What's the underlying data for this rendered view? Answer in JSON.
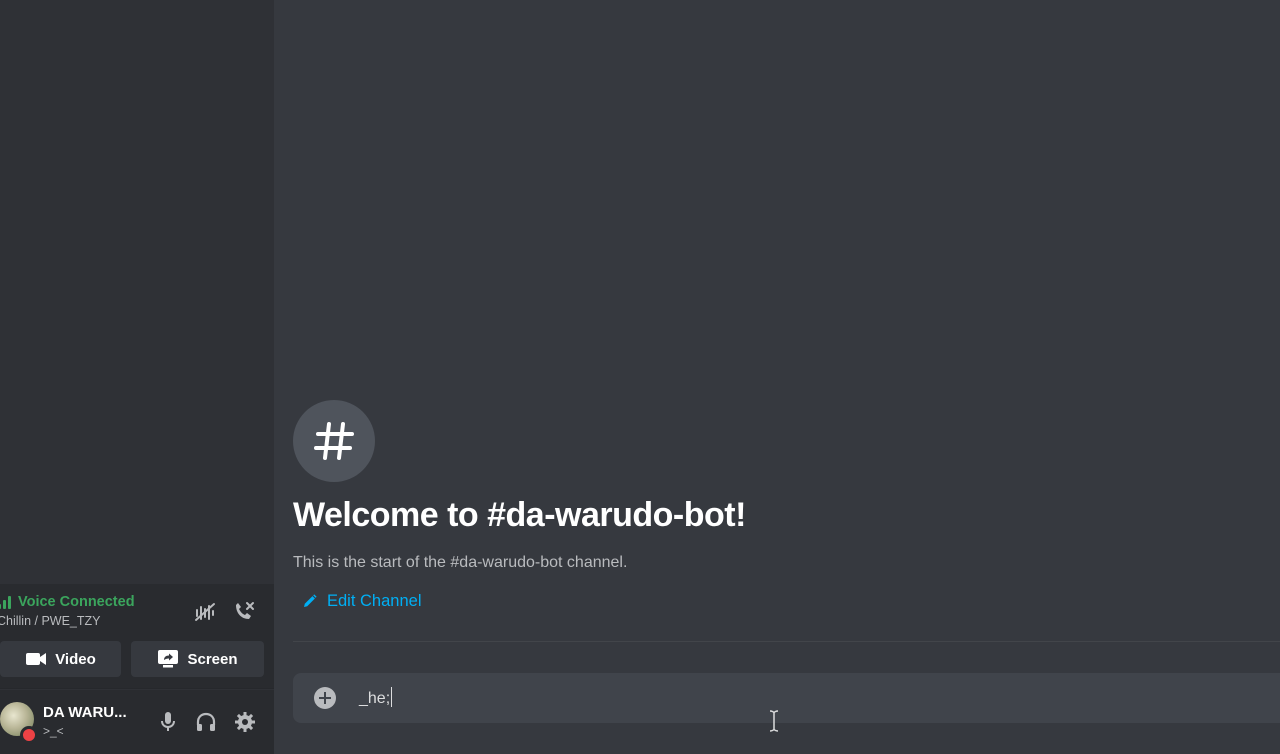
{
  "sidebar": {
    "voice": {
      "status": "Voice Connected",
      "channel": "Chillin / PWE_TZY",
      "video_label": "Video",
      "screen_label": "Screen"
    },
    "user": {
      "name": "DA WARU...",
      "tag": ">_<",
      "status": "dnd"
    }
  },
  "main": {
    "welcome_title": "Welcome to #da-warudo-bot!",
    "welcome_subtitle": "This is the start of the #da-warudo-bot channel.",
    "edit_channel_label": "Edit Channel",
    "channel_symbol": "#",
    "composer": {
      "value": "_he;"
    }
  },
  "colors": {
    "accent_green": "#3ba55d",
    "link_blue": "#00aff4",
    "dnd_red": "#ed4245"
  },
  "icons": {
    "voice_signal": "signal-bars-icon",
    "noise_suppression": "noise-suppression-icon",
    "disconnect": "phone-disconnect-icon",
    "video": "video-camera-icon",
    "screen": "screen-share-icon",
    "mic": "microphone-icon",
    "headphones": "headphones-icon",
    "settings": "gear-icon",
    "edit": "pencil-icon",
    "attach": "plus-circle-icon",
    "channel": "hashtag-icon"
  }
}
